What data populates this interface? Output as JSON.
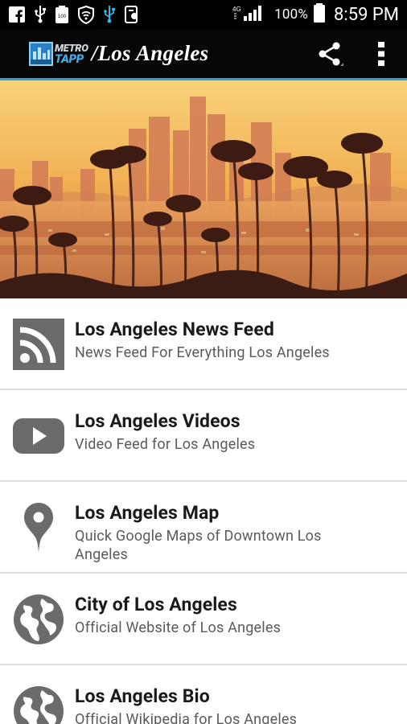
{
  "status_bar": {
    "battery_percent": "100%",
    "time": "8:59 PM",
    "icons": [
      "facebook-icon",
      "usb-icon",
      "battery-saver-icon",
      "wifi-shield-icon",
      "usb-debug-icon",
      "screenshot-icon",
      "signal-icon",
      "battery-icon"
    ]
  },
  "app_bar": {
    "logo_word_1": "METRO",
    "logo_word_2": "TAPP",
    "title": "/Los Angeles",
    "actions": [
      "share-icon",
      "overflow-menu-icon"
    ],
    "background_color": "#070707",
    "accent_color": "#1ea6d8"
  },
  "hero": {
    "image": "Los Angeles skyline with palm trees at sunset"
  },
  "menu": {
    "items": [
      {
        "icon": "rss-feed-icon",
        "title": "Los Angeles News Feed",
        "subtitle": "News Feed For Everything Los Angeles"
      },
      {
        "icon": "youtube-play-icon",
        "title": "Los Angeles Videos",
        "subtitle": "Video Feed for Los Angeles"
      },
      {
        "icon": "map-pin-icon",
        "title": "Los Angeles Map",
        "subtitle": "Quick Google Maps of Downtown Los Angeles"
      },
      {
        "icon": "globe-icon",
        "title": "City of Los Angeles",
        "subtitle": "Official Website of Los Angeles"
      },
      {
        "icon": "globe-icon",
        "title": "Los Angeles Bio",
        "subtitle": "Official Wikipedia for Los Angeles"
      }
    ],
    "icon_color": "#6b6b6b"
  }
}
